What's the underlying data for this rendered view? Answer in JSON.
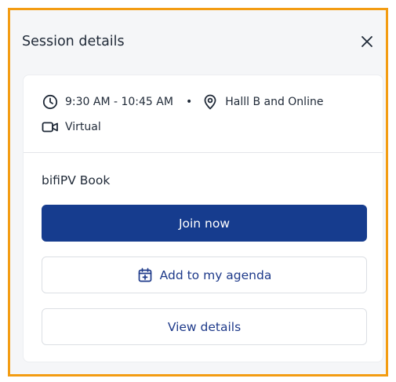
{
  "panel": {
    "title": "Session details",
    "border_color": "#f39c12",
    "close_icon": "close-icon"
  },
  "session": {
    "time": "9:30 AM - 10:45 AM",
    "separator": "•",
    "location": "Halll B and Online",
    "format": "Virtual",
    "name": "bifiPV Book",
    "icons": {
      "time": "clock-icon",
      "location": "map-pin-icon",
      "format": "video-camera-icon"
    }
  },
  "actions": {
    "join_label": "Join now",
    "agenda_label": "Add to my agenda",
    "agenda_icon": "calendar-plus-icon",
    "details_label": "View details"
  },
  "colors": {
    "primary": "#163c8e",
    "link_text": "#1e3a8a",
    "text": "#1f2937"
  }
}
